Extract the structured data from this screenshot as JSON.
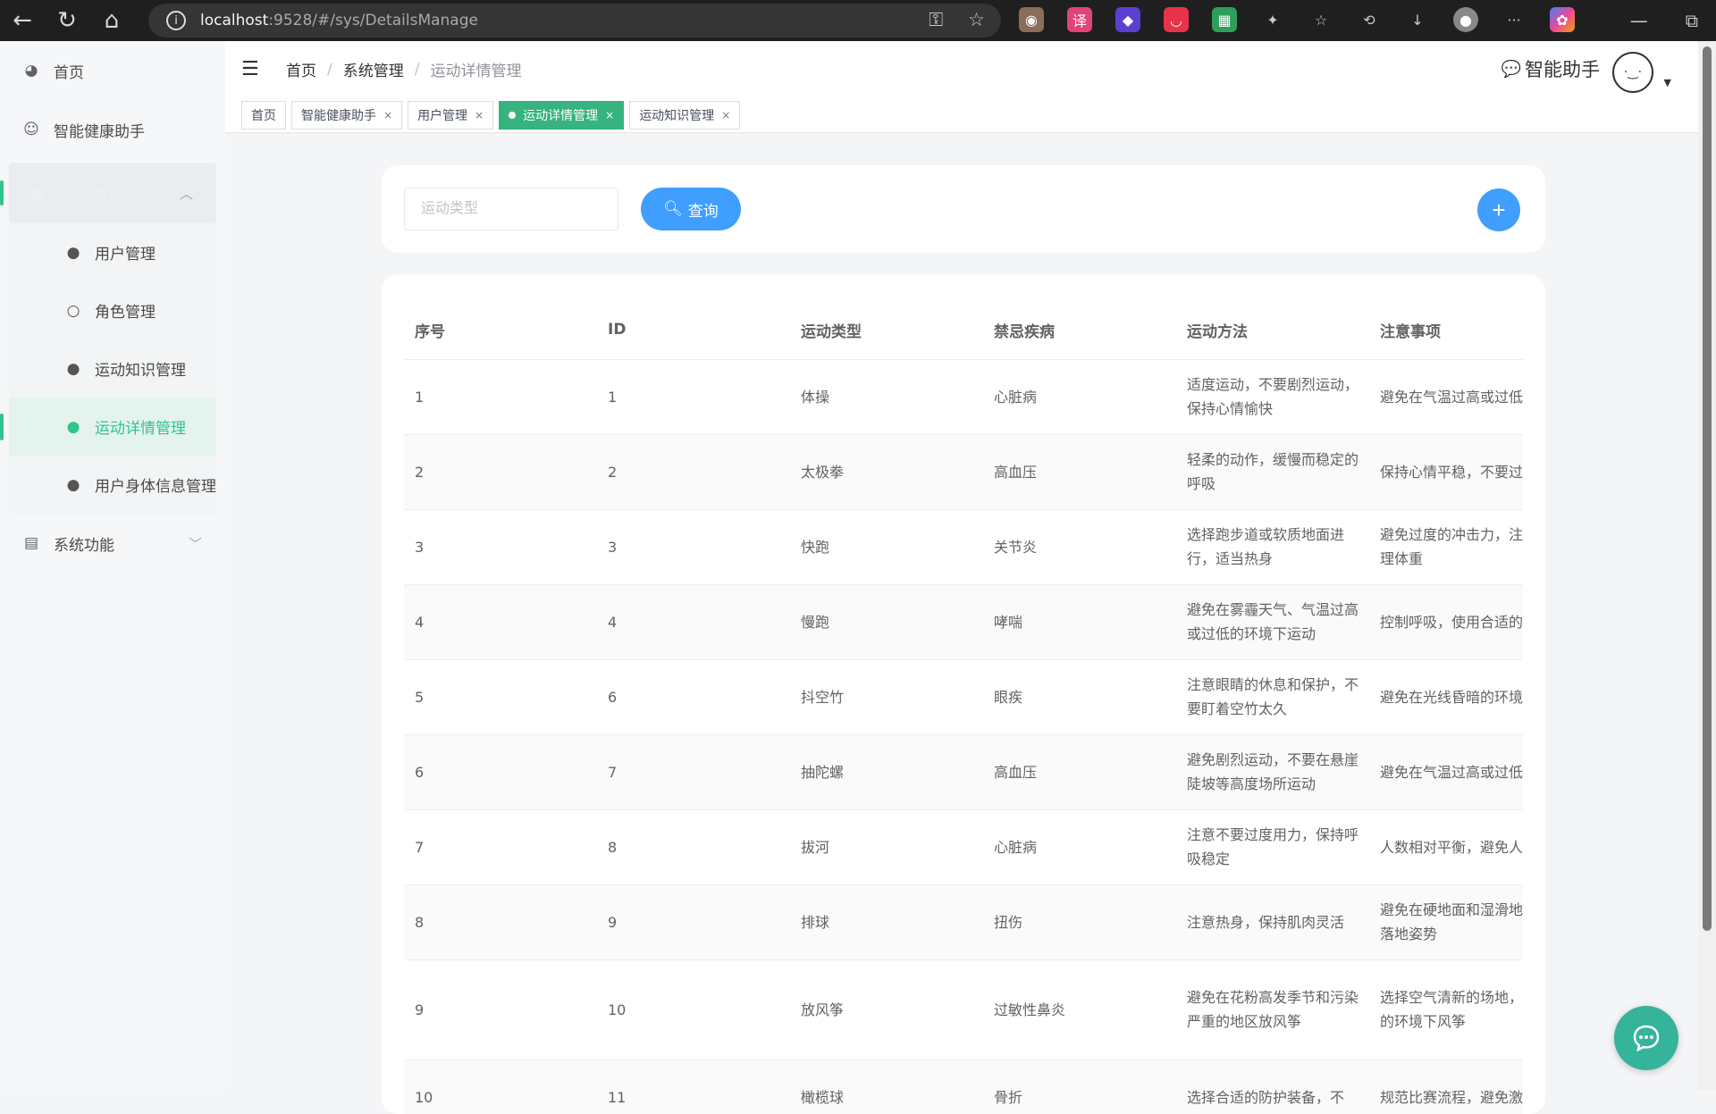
{
  "browser": {
    "url_host": "localhost",
    "url_path": ":9528/#/sys/DetailsManage"
  },
  "sidebar": {
    "home": "首页",
    "assistant": "智能健康助手",
    "group_open_label": "系统管理",
    "submenu": [
      "用户管理",
      "角色管理",
      "运动知识管理",
      "运动详情管理",
      "用户身体信息管理"
    ],
    "system_functions": "系统功能"
  },
  "header": {
    "breadcrumb": [
      "首页",
      "系统管理",
      "运动详情管理"
    ],
    "assistant_label": "智能助手"
  },
  "tags": [
    {
      "label": "首页",
      "closable": false,
      "active": false
    },
    {
      "label": "智能健康助手",
      "closable": true,
      "active": false
    },
    {
      "label": "用户管理",
      "closable": true,
      "active": false
    },
    {
      "label": "运动详情管理",
      "closable": true,
      "active": true
    },
    {
      "label": "运动知识管理",
      "closable": true,
      "active": false
    }
  ],
  "search": {
    "placeholder": "运动类型",
    "query_label": "查询"
  },
  "table": {
    "headers": [
      "序号",
      "ID",
      "运动类型",
      "禁忌疾病",
      "运动方法",
      "注意事项"
    ],
    "rows": [
      [
        "1",
        "1",
        "体操",
        "心脏病",
        "适度运动，不要剧烈运动，保持心情愉快",
        "避免在气温过高或过低环境下运动"
      ],
      [
        "2",
        "2",
        "太极拳",
        "高血压",
        "轻柔的动作，缓慢而稳定的呼吸",
        "保持心情平稳，不要过紧张"
      ],
      [
        "3",
        "3",
        "快跑",
        "关节炎",
        "选择跑步道或软质地面进行，适当热身",
        "避免过度的冲击力，注饮食，保持合理体重"
      ],
      [
        "4",
        "4",
        "慢跑",
        "哮喘",
        "避免在雾霾天气、气温过高或过低的环境下运动",
        "控制呼吸，使用合适的护装备"
      ],
      [
        "5",
        "6",
        "抖空竹",
        "眼疾",
        "注意眼睛的休息和保护，不要盯着空竹太久",
        "避免在光线昏暗的环境玩抖空竹"
      ],
      [
        "6",
        "7",
        "抽陀螺",
        "高血压",
        "避免剧烈运动，不要在悬崖陡坡等高度场所运动",
        "避免在气温过高或过低环境下运动"
      ],
      [
        "7",
        "8",
        "拔河",
        "心脏病",
        "注意不要过度用力，保持呼吸稳定",
        "人数相对平衡，避免人不足或过多"
      ],
      [
        "8",
        "9",
        "排球",
        "扭伤",
        "注意热身，保持肌肉灵活",
        "避免在硬地面和湿滑地上运动，注意落地姿势"
      ],
      [
        "9",
        "10",
        "放风筝",
        "过敏性鼻炎",
        "避免在花粉高发季节和污染严重的地区放风筝",
        "选择空气清新的场地，要在风力过大的环境下风筝"
      ],
      [
        "10",
        "11",
        "橄榄球",
        "骨折",
        "选择合适的防护装备，不",
        "规范比赛流程，避免激"
      ]
    ]
  }
}
